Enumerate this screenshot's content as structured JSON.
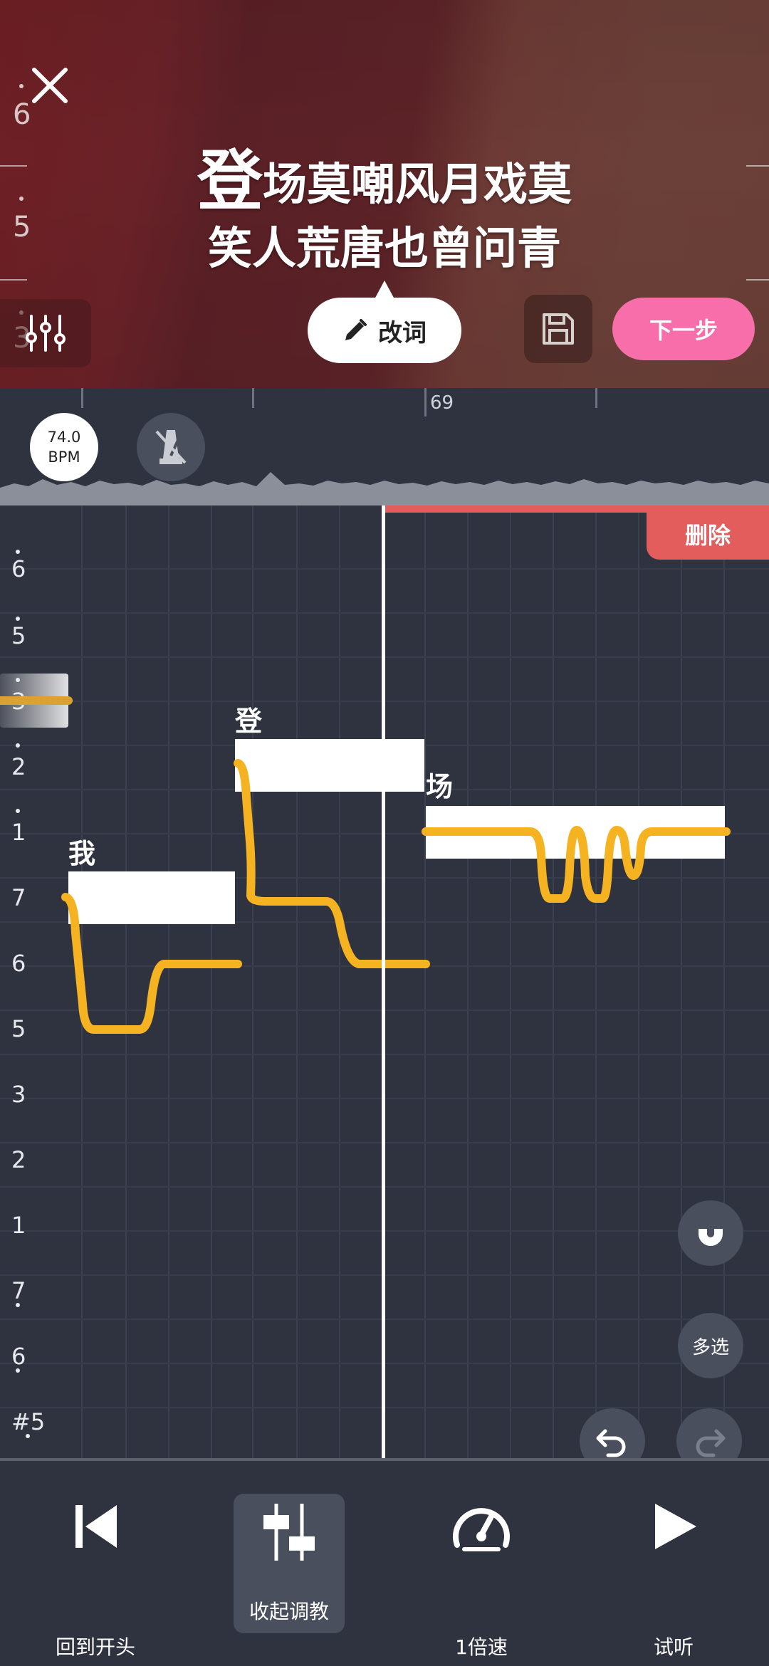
{
  "header": {
    "lyric_line1_current": "登",
    "lyric_line1_rest": "场莫嘲风月戏莫",
    "lyric_line2": "笑人荒唐也曾问青",
    "side_numbers": [
      "6",
      "5",
      "3"
    ],
    "edit_label": "改词",
    "next_label": "下一步"
  },
  "timeline": {
    "ruler_label": "69",
    "bpm_value": "74.0",
    "bpm_unit": "BPM"
  },
  "editor": {
    "delete_label": "删除",
    "pitch_labels": [
      "6",
      "5",
      "3",
      "2",
      "1",
      "7",
      "6",
      "5",
      "3",
      "2",
      "1",
      "7",
      "6",
      "#5"
    ],
    "notes": [
      {
        "lyric": "我"
      },
      {
        "lyric": "登"
      },
      {
        "lyric": "场"
      }
    ],
    "multi_select_label": "多选"
  },
  "toolbar": {
    "rewind_label": "回到开头",
    "collapse_label": "收起调教",
    "speed_label": "1倍速",
    "preview_label": "试听"
  },
  "colors": {
    "accent_pink": "#f76eab",
    "delete_red": "#e35d5d",
    "pitch_curve": "#f6b321",
    "background": "#2f3340"
  }
}
